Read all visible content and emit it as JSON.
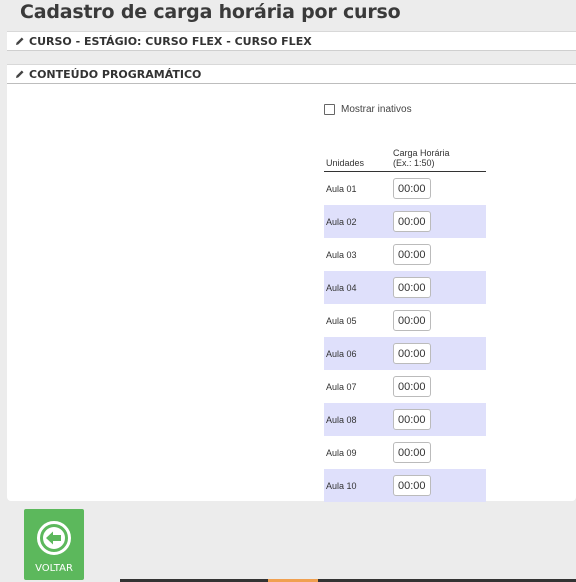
{
  "page_title": "Cadastro de carga horária por curso",
  "panels": {
    "curso": {
      "title": "CURSO - ESTÁGIO: CURSO FLEX - CURSO FLEX"
    },
    "conteudo": {
      "title": "CONTEÚDO PROGRAMÁTICO"
    }
  },
  "filters": {
    "mostrar_inativos_label": "Mostrar inativos",
    "mostrar_inativos_checked": false
  },
  "table": {
    "headers": {
      "unidades": "Unidades",
      "carga_horaria": "Carga Horária",
      "carga_horaria_hint": "(Ex.: 1:50)"
    },
    "rows": [
      {
        "unidade": "Aula 01",
        "carga": "00:00"
      },
      {
        "unidade": "Aula 02",
        "carga": "00:00"
      },
      {
        "unidade": "Aula 03",
        "carga": "00:00"
      },
      {
        "unidade": "Aula 04",
        "carga": "00:00"
      },
      {
        "unidade": "Aula 05",
        "carga": "00:00"
      },
      {
        "unidade": "Aula 06",
        "carga": "00:00"
      },
      {
        "unidade": "Aula 07",
        "carga": "00:00"
      },
      {
        "unidade": "Aula 08",
        "carga": "00:00"
      },
      {
        "unidade": "Aula 09",
        "carga": "00:00"
      },
      {
        "unidade": "Aula 10",
        "carga": "00:00"
      }
    ]
  },
  "actions": {
    "voltar_label": "VOLTAR"
  },
  "colors": {
    "row_alt": "#dfe0fb",
    "voltar_bg": "#5cb85c"
  },
  "icons": {
    "panel_header": "pencil-icon",
    "voltar": "arrow-left-circle-icon"
  }
}
